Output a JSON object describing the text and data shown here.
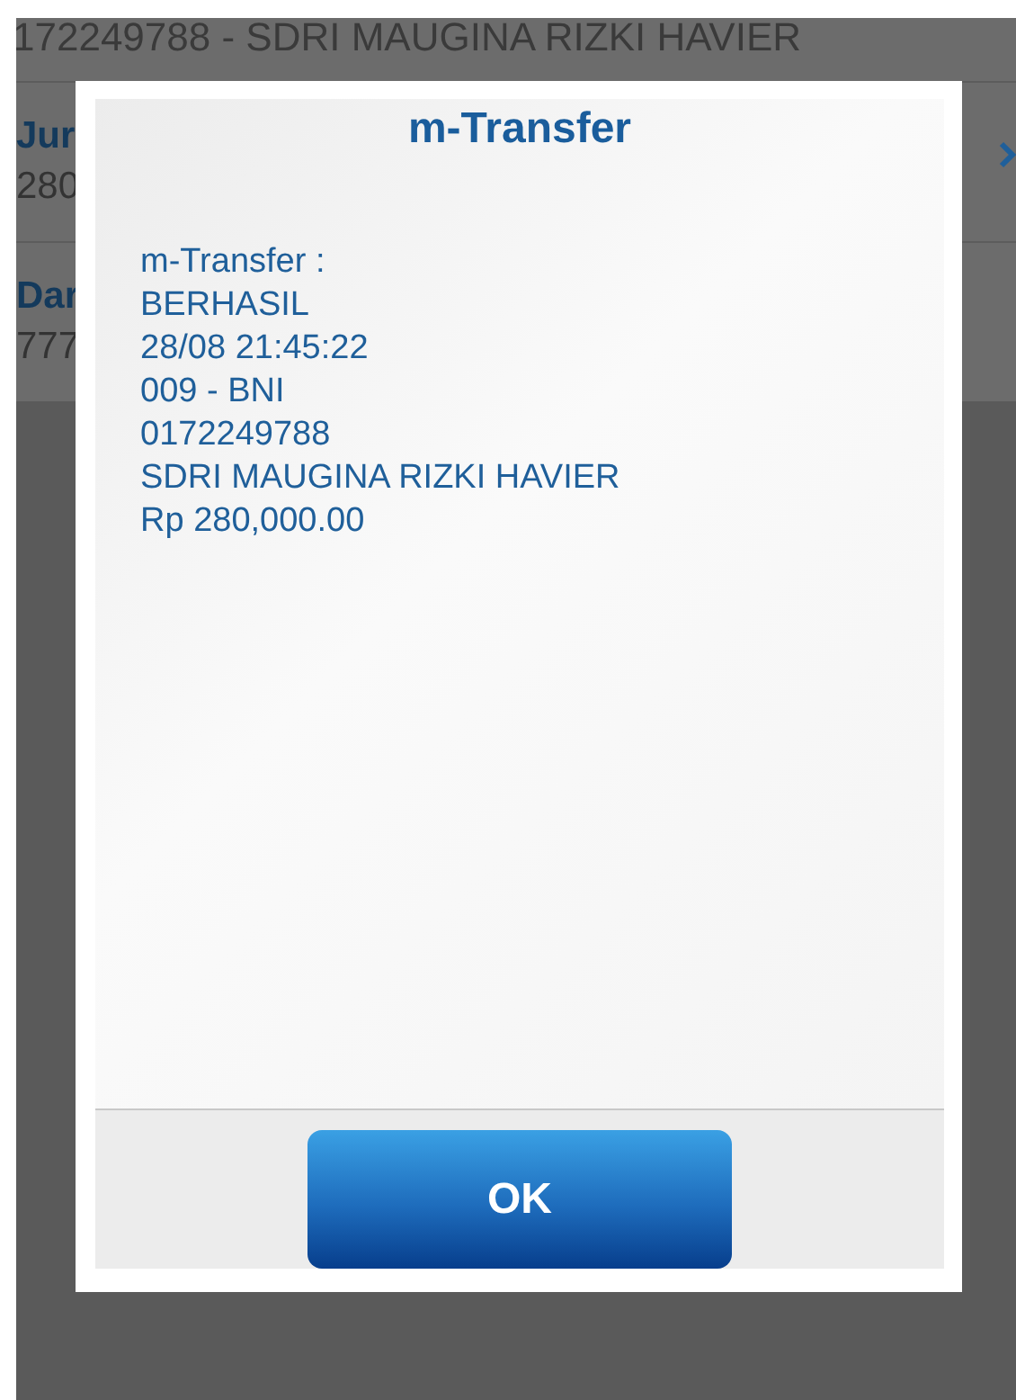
{
  "background": {
    "header": "172249788 - SDRI MAUGINA RIZKI HAVIER",
    "rows": [
      {
        "label": "Jur",
        "value": "280",
        "chevron": true
      },
      {
        "label": "Dar",
        "value": "777",
        "chevron": false
      }
    ]
  },
  "dialog": {
    "title": "m-Transfer",
    "lines": [
      "m-Transfer :",
      "BERHASIL",
      "28/08 21:45:22",
      "009 - BNI",
      "0172249788",
      "SDRI MAUGINA RIZKI HAVIER",
      "Rp 280,000.00"
    ],
    "button": "OK"
  }
}
